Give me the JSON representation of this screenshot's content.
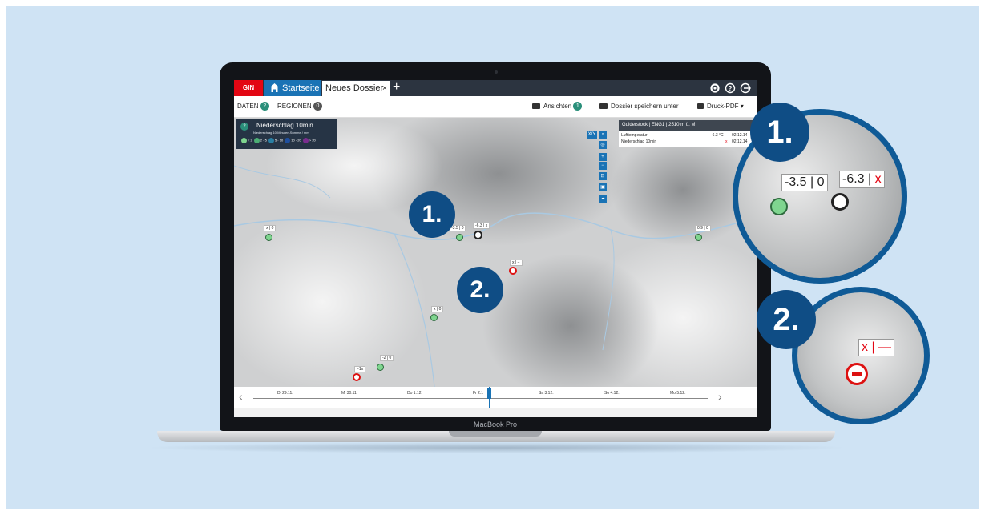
{
  "header": {
    "app_badge": "GIN",
    "tabs": [
      {
        "label": "Startseite",
        "icon": "home-icon"
      },
      {
        "label": "Neues Dossier",
        "close": "×"
      }
    ],
    "add_tab": "+",
    "right_icons": [
      "gear-icon",
      "help-icon",
      "logout-icon"
    ]
  },
  "toolbar": {
    "daten_label": "DATEN",
    "daten_count": "2",
    "regionen_label": "REGIONEN",
    "regionen_count": "0",
    "ansichten_label": "Ansichten",
    "ansichten_count": "1",
    "save_label": "Dossier speichern unter",
    "print_label": "Druck-PDF"
  },
  "legend": {
    "number": "2",
    "title": "Niederschlag 10min",
    "subtitle": "Niederschlag 10-Minuten-Summe / mm",
    "classes": [
      {
        "label": "< 2",
        "color": "#7fd58f"
      },
      {
        "label": "2 - 5",
        "color": "#4cae74"
      },
      {
        "label": "5 - 10",
        "color": "#2a7fa3"
      },
      {
        "label": "10 - 20",
        "color": "#1f4f9e"
      },
      {
        "label": "> 20",
        "color": "#7a2d8f"
      }
    ]
  },
  "map_tools": [
    "X/Y",
    "search-icon",
    "globe-icon",
    "+",
    "−",
    "layers-icon",
    "measure-icon",
    "cloud-icon"
  ],
  "info_panel": {
    "title": "Gulderstock | ENG1 | 2510 m ü. M.",
    "rows": [
      {
        "label": "Lufttemperatur",
        "value": "-6.3 °C",
        "time": "02.12.14"
      },
      {
        "label": "Niederschlag 10min",
        "value": "x",
        "time": "02.12.14"
      }
    ]
  },
  "map_labels": {
    "station_a": "-3.5 | 0",
    "station_b": "-6.3 | x",
    "station_c": "x | −",
    "station_d": "x | 0",
    "station_e": "x | 0",
    "station_f": "-2 | 0",
    "station_g": "−1x",
    "station_h": "0.9 | 0"
  },
  "callouts": {
    "first": "1.",
    "second": "2."
  },
  "zoom1": {
    "number": "1.",
    "label_left": "-3.5 | 0",
    "label_right_value": "-6.3 |",
    "label_right_flag": "x"
  },
  "zoom2": {
    "number": "2.",
    "label_flag": "x",
    "label_rest": "| —"
  },
  "timeline": {
    "days": [
      "Di 29.11.",
      "Mi 30.11.",
      "Do 1.12.",
      "Fr 2.1",
      "Sa 3.12.",
      "So 4.12.",
      "Mo 5.12."
    ],
    "prev": "‹",
    "next": "›"
  },
  "device_label": "MacBook Pro",
  "colors": {
    "accent": "#1a73b5",
    "brand_red": "#e30613",
    "callout": "#0f4d85",
    "background": "#cfe3f4"
  }
}
